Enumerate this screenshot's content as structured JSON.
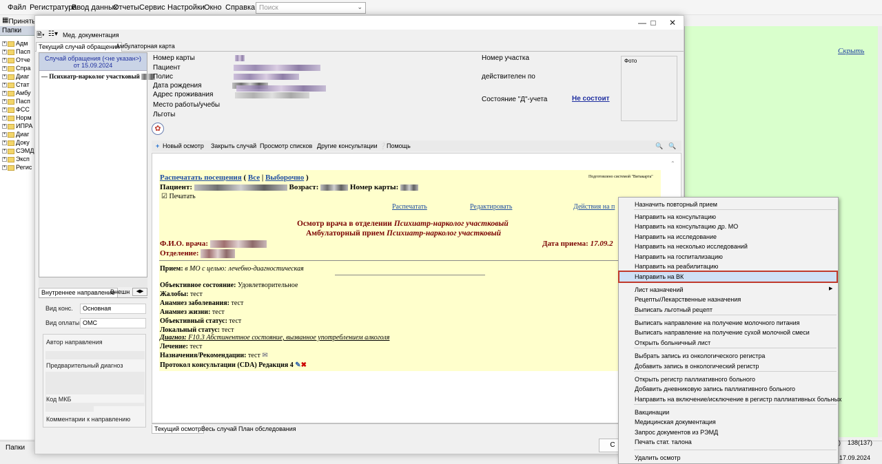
{
  "menubar": {
    "items": [
      "Файл",
      "Регистратура",
      "Ввод данных",
      "Отчеты",
      "Сервис",
      "Настройки",
      "Окно",
      "Справка"
    ],
    "search_placeholder": "Поиск"
  },
  "toolbar2": {
    "accept": "Принять"
  },
  "folders": {
    "header": "Папки",
    "items": [
      "Адм",
      "Пасп",
      "Отче",
      "Спра",
      "Диаг",
      "Стат",
      "Амбу",
      "Пасп",
      "ФСС",
      "Норм",
      "ИПРА",
      "Диаг",
      "Доку",
      "СЭМД",
      "Эксп",
      "Регис"
    ],
    "bottom_tab": "Папки"
  },
  "right_panel": {
    "hide_link": "Скрыть",
    "status_num": "138(137)",
    "date": "17.09.2024",
    "status_p": "р)"
  },
  "window": {
    "toolbar_label": "Мед. документация",
    "tabs": [
      "Текущий случай обращения",
      "Амбулаторная карта"
    ],
    "case": {
      "line1": "Случай обращения (<не указан>)",
      "line2": "от 15.09.2024"
    },
    "doctor": "Психиатр-нарколог участковый",
    "napr_tabs": [
      "Внутреннее направление",
      "Внешн"
    ],
    "vid_kons_label": "Вид конс.",
    "vid_kons": "Основная",
    "vid_oplaty_label": "Вид оплаты",
    "vid_oplaty": "ОМС",
    "author": "Автор направления",
    "prelim": "Предварительный диагноз",
    "mkb": "Код МКБ",
    "comment": "Комментарии к направлению",
    "patient_labels": [
      "Номер карты",
      "Пациент",
      "Полис",
      "Дата рождения",
      "Адрес проживания",
      "Место работы/учебы",
      "Льготы"
    ],
    "uchastok": "Номер участка",
    "valid_to": "действителен по",
    "d_state_label": "Состояние \"Д\"-учета",
    "d_state": "Не состоит",
    "photo": "Фото",
    "actions": [
      "Новый осмотр",
      "Закрыть случай",
      "Просмотр списков",
      "Другие консультации",
      "Помощь"
    ],
    "bottom_tabs": [
      "Текущий осмотр",
      "Весь случай",
      "План обследования"
    ],
    "btn_partial": "С"
  },
  "doc": {
    "print_visits": "Распечатать посещения",
    "all": "Все",
    "selected": "Выборочно",
    "prepared": "Подготовлено системой \"Витакарта\"",
    "patient_label": "Пациент:",
    "age_label": "Возраст:",
    "card_label": "Номер карты:",
    "print_checkbox": "Печатать",
    "print_link": "Распечатать",
    "edit_link": "Редактировать",
    "actions_link": "Действия на п",
    "title1_a": "Осмотр врача в отделении ",
    "title1_b": "Психиатр-нарколог участковый",
    "title2_a": "Амбулаторный прием ",
    "title2_b": "Психиатр-нарколог участковый",
    "fio_label": "Ф.И.О. врача:",
    "date_label": "Дата приема: ",
    "date_value": "17.09.2",
    "dept_label": "Отделение:",
    "priem_label": "Прием:",
    "priem_text": "в МО с целью:",
    "priem_value": "лечебно-диагностическая",
    "lines": [
      {
        "label": "Объективное состояние:",
        "value": "Удовлетворительное"
      },
      {
        "label": "Жалобы:",
        "value": "тест"
      },
      {
        "label": "Анамнез заболевания:",
        "value": "тест"
      },
      {
        "label": "Анамнез жизни:",
        "value": "тест"
      },
      {
        "label": "Объективный статус:",
        "value": "тест"
      },
      {
        "label": "Локальный статус:",
        "value": "тест"
      }
    ],
    "diag_label": "Диагноз:",
    "diag_value": "F10.3 Абстинентное состояние, вызванное употреблением алкоголя",
    "treat_label": "Лечение:",
    "treat_value": "тест",
    "rec_label": "Назначения/Рекомендации:",
    "rec_value": "тест",
    "protocol": "Протокол консультации (CDA) Редакция 4"
  },
  "context_menu": {
    "items": [
      "Назначить повторный прием",
      "Направить на консультацию",
      "Направить на консультацию др. МО",
      "Направить на исследование",
      "Направить на несколько исследований",
      "Направить на госпитализацию",
      "Направить на реабилитацию",
      "Направить на ВК",
      "Лист назначений",
      "Рецепты/Лекарственные назначения",
      "Выписать льготный рецепт",
      "Выписать направление на получение молочного питания",
      "Выписать направление на получение сухой молочной смеси",
      "Открыть больничный лист",
      "Выбрать запись из онкологического регистра",
      "Добавить запись в онкологический регистр",
      "Открыть регистр паллиативного больного",
      "Добавить дневниковую запись паллиативного больного",
      "Направить на включение/исключение в регистр паллиативных больных",
      "Вакцинации",
      "Медицинская документация",
      "Запрос документов из РЭМД",
      "Печать стат. талона",
      "Удалить осмотр"
    ],
    "highlighted": "Направить на ВК"
  }
}
